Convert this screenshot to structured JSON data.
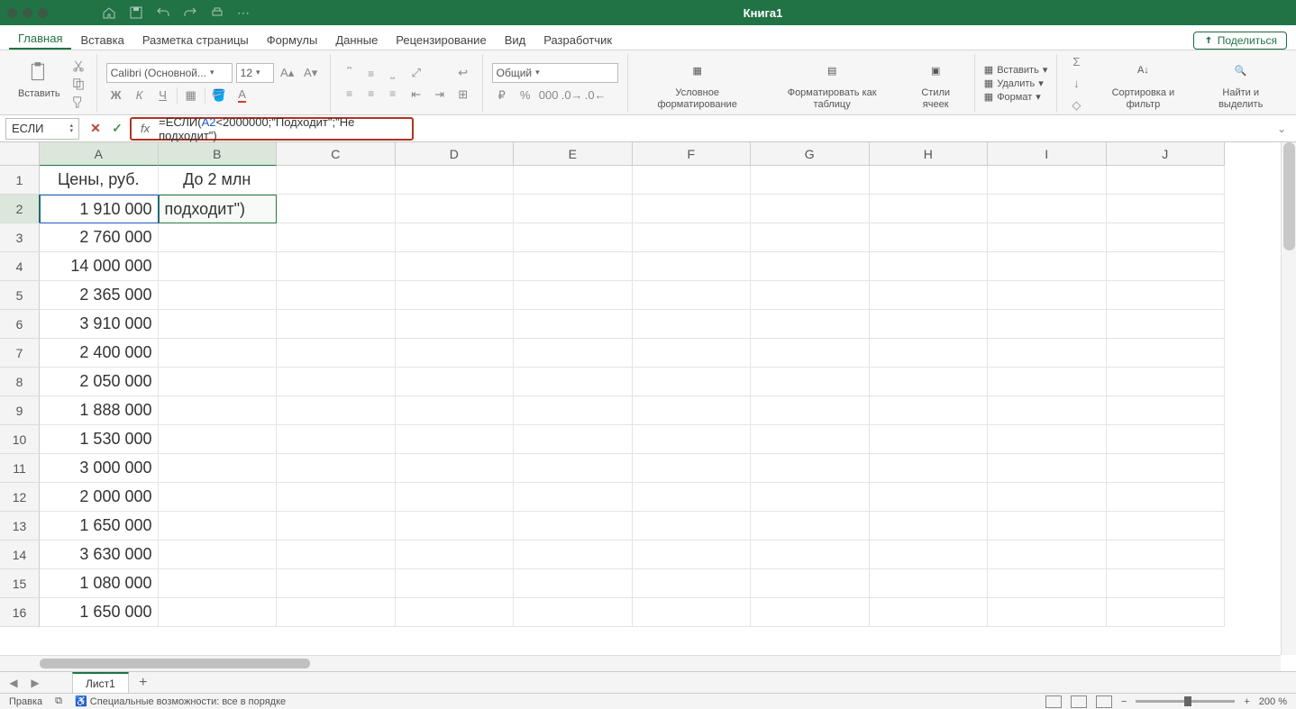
{
  "title": "Книга1",
  "tabs": [
    "Главная",
    "Вставка",
    "Разметка страницы",
    "Формулы",
    "Данные",
    "Рецензирование",
    "Вид",
    "Разработчик"
  ],
  "active_tab": "Главная",
  "share_label": "Поделиться",
  "ribbon": {
    "paste": "Вставить",
    "font_name": "Calibri (Основной...",
    "font_size": "12",
    "number_format": "Общий",
    "cond_format": "Условное форматирование",
    "fmt_table": "Форматировать как таблицу",
    "cell_styles": "Стили ячеек",
    "insert": "Вставить",
    "delete": "Удалить",
    "format": "Формат",
    "sort_filter": "Сортировка и фильтр",
    "find_select": "Найти и выделить"
  },
  "namebox": "ЕСЛИ",
  "formula": {
    "prefix": "=ЕСЛИ(",
    "ref": "A2",
    "rest": "<2000000;\"Подходит\";\"Не подходит\")"
  },
  "columns": [
    "A",
    "B",
    "C",
    "D",
    "E",
    "F",
    "G",
    "H",
    "I",
    "J"
  ],
  "rows": [
    "1",
    "2",
    "3",
    "4",
    "5",
    "6",
    "7",
    "8",
    "9",
    "10",
    "11",
    "12",
    "13",
    "14",
    "15",
    "16"
  ],
  "cells": {
    "A1": "Цены, руб.",
    "B1": "До 2 млн",
    "B2": "подходит\")",
    "A": [
      "1 910 000",
      "2 760 000",
      "14 000 000",
      "2 365 000",
      "3 910 000",
      "2 400 000",
      "2 050 000",
      "1 888 000",
      "1 530 000",
      "3 000 000",
      "2 000 000",
      "1 650 000",
      "3 630 000",
      "1 080 000",
      "1 650 000"
    ]
  },
  "sheet_tab": "Лист1",
  "status": {
    "mode": "Правка",
    "accessibility": "Специальные возможности: все в порядке",
    "zoom": "200 %"
  }
}
